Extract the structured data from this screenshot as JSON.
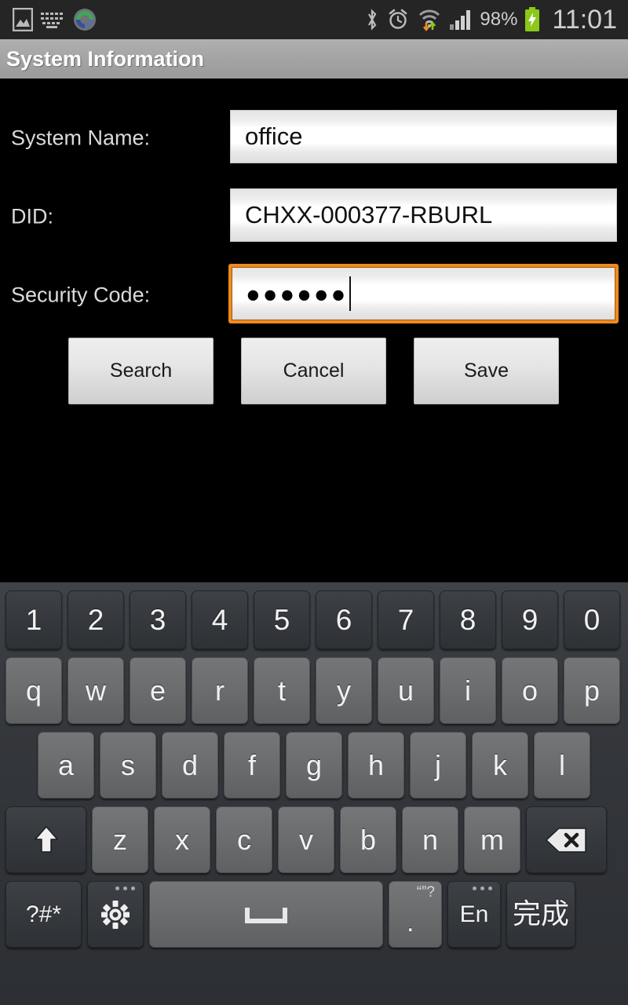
{
  "status_bar": {
    "left_icons": [
      "screenshot-image-icon",
      "keyboard-icon",
      "sync-circle-icon"
    ],
    "right_icons": [
      "bluetooth-icon",
      "alarm-clock-icon",
      "wifi-data-transfer-icon",
      "signal-bars-icon",
      "battery-charging-icon"
    ],
    "battery_percent": "98%",
    "clock": "11:01"
  },
  "title_bar": {
    "title": "System Information"
  },
  "form": {
    "rows": [
      {
        "label": "System Name:",
        "value": "office",
        "focused": false
      },
      {
        "label": "DID:",
        "value": "CHXX-000377-RBURL",
        "focused": false
      },
      {
        "label": "Security Code:",
        "value": "●●●●●●",
        "focused": true
      }
    ]
  },
  "buttons": {
    "search": "Search",
    "cancel": "Cancel",
    "save": "Save"
  },
  "keyboard": {
    "row1": [
      "1",
      "2",
      "3",
      "4",
      "5",
      "6",
      "7",
      "8",
      "9",
      "0"
    ],
    "row2": [
      "q",
      "w",
      "e",
      "r",
      "t",
      "y",
      "u",
      "i",
      "o",
      "p"
    ],
    "row3": [
      "a",
      "s",
      "d",
      "f",
      "g",
      "h",
      "j",
      "k",
      "l"
    ],
    "row4_letters": [
      "z",
      "x",
      "c",
      "v",
      "b",
      "n",
      "m"
    ],
    "shift_icon": "shift-arrow-icon",
    "backspace_icon": "backspace-icon",
    "symbols_key": "?#*",
    "settings_icon": "gear-icon",
    "space_icon": "space-bar-icon",
    "period_key": ".",
    "period_hint": "“”?",
    "language_key": "En",
    "done_key": "完成"
  },
  "colors": {
    "background": "#000000",
    "title_bar": "#a5a5a5",
    "focus_orange": "#f08a1e",
    "battery_green": "#8bc819",
    "keyboard_bg": "#35383c",
    "key_dark": "#35383c",
    "key_light": "#6a6c6e"
  }
}
